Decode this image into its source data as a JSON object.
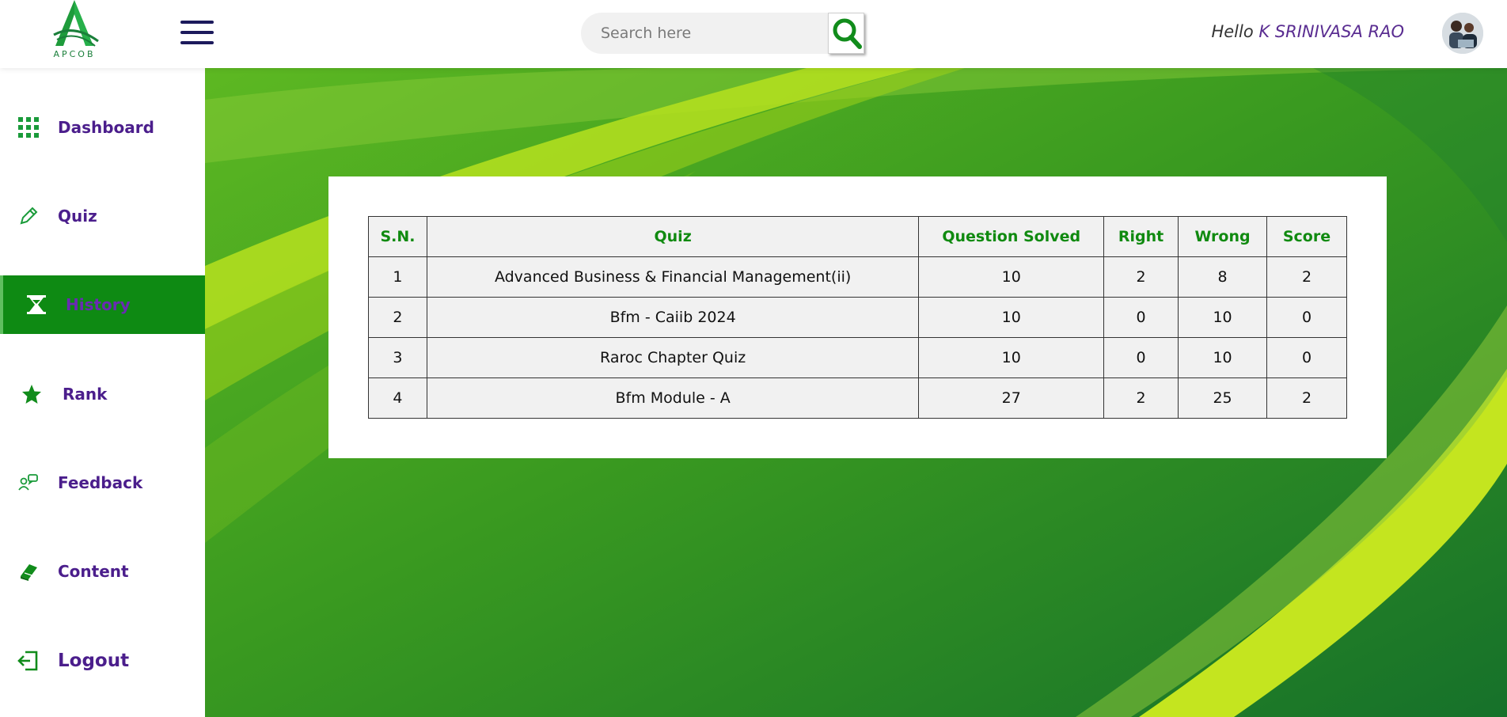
{
  "header": {
    "logo_text": "APCOB",
    "search_placeholder": "Search here",
    "greeting_prefix": "Hello",
    "user_name": "K SRINIVASA RAO"
  },
  "sidebar": {
    "items": [
      {
        "label": "Dashboard",
        "icon": "grid-icon"
      },
      {
        "label": "Quiz",
        "icon": "pencil-icon"
      },
      {
        "label": "History",
        "icon": "hourglass-icon",
        "active": true
      },
      {
        "label": "Rank",
        "icon": "star-icon"
      },
      {
        "label": "Feedback",
        "icon": "feedback-icon"
      },
      {
        "label": "Content",
        "icon": "book-icon"
      },
      {
        "label": "Logout",
        "icon": "logout-icon"
      }
    ]
  },
  "history_table": {
    "columns": [
      "S.N.",
      "Quiz",
      "Question Solved",
      "Right",
      "Wrong",
      "Score"
    ],
    "rows": [
      [
        "1",
        "Advanced Business & Financial Management(ii)",
        "10",
        "2",
        "8",
        "2"
      ],
      [
        "2",
        "Bfm - Caiib 2024",
        "10",
        "0",
        "10",
        "0"
      ],
      [
        "3",
        "Raroc Chapter Quiz",
        "10",
        "0",
        "10",
        "0"
      ],
      [
        "4",
        "Bfm Module - A",
        "27",
        "2",
        "25",
        "2"
      ]
    ]
  },
  "colors": {
    "accent_green": "#0e8a13",
    "header_text_green": "#108a10",
    "nav_purple": "#4b1e8c",
    "username_purple": "#5a2d91"
  }
}
